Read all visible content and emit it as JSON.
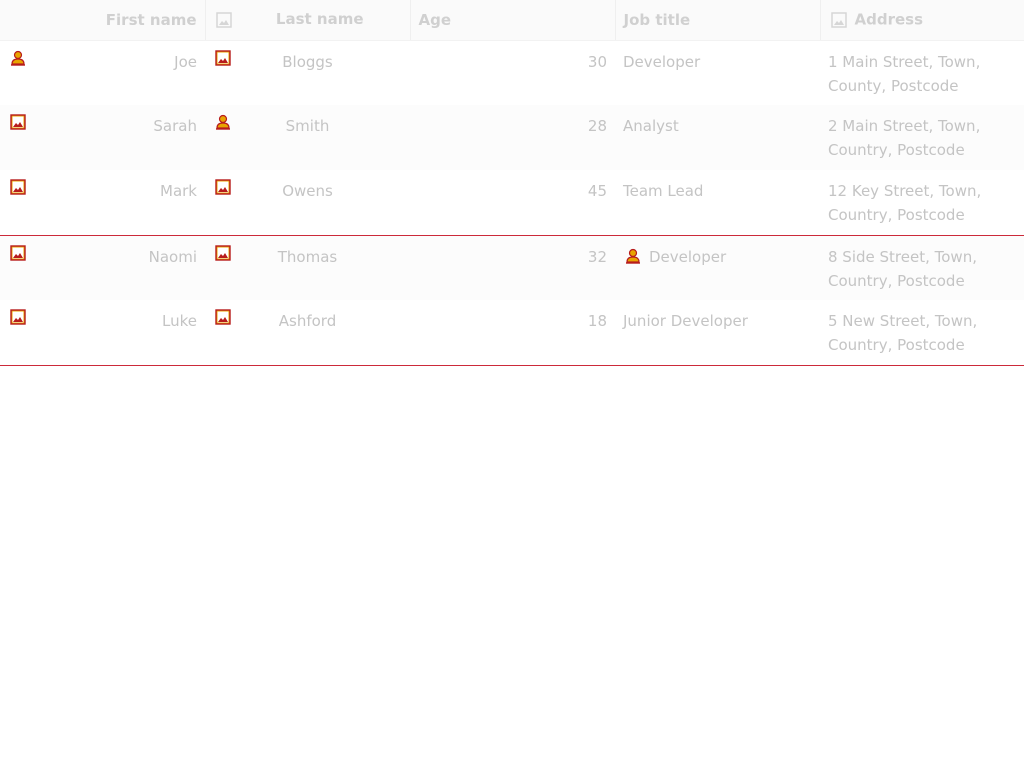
{
  "columns": {
    "first_name": "First name",
    "last_name": "Last name",
    "age": "Age",
    "job_title": "Job title",
    "address": "Address"
  },
  "icons": {
    "header_col2": "image-icon",
    "header_address": "image-icon",
    "accent": "#e8a400",
    "stroke": "#b71c1c"
  },
  "rows": [
    {
      "icon1": "person-icon",
      "first": "Joe",
      "icon2": "image-icon",
      "last": "Bloggs",
      "age": "30",
      "job": "Developer",
      "job_icon": "",
      "address": "1 Main Street, Town, County, Postcode"
    },
    {
      "icon1": "image-icon",
      "first": "Sarah",
      "icon2": "person-icon",
      "last": "Smith",
      "age": "28",
      "job": "Analyst",
      "job_icon": "",
      "address": "2 Main Street, Town, Country, Postcode"
    },
    {
      "icon1": "image-icon",
      "first": "Mark",
      "icon2": "image-icon",
      "last": "Owens",
      "age": "45",
      "job": "Team Lead",
      "job_icon": "",
      "address": "12 Key Street, Town, Country, Postcode"
    },
    {
      "icon1": "image-icon",
      "first": "Naomi",
      "icon2": "image-icon",
      "last": "Thomas",
      "age": "32",
      "job": "Developer",
      "job_icon": "person-icon",
      "address": "8 Side Street, Town, Country, Postcode"
    },
    {
      "icon1": "image-icon",
      "first": "Luke",
      "icon2": "image-icon",
      "last": "Ashford",
      "age": "18",
      "job": "Junior Developer",
      "job_icon": "",
      "address": "5 New Street, Town, Country, Postcode"
    }
  ]
}
